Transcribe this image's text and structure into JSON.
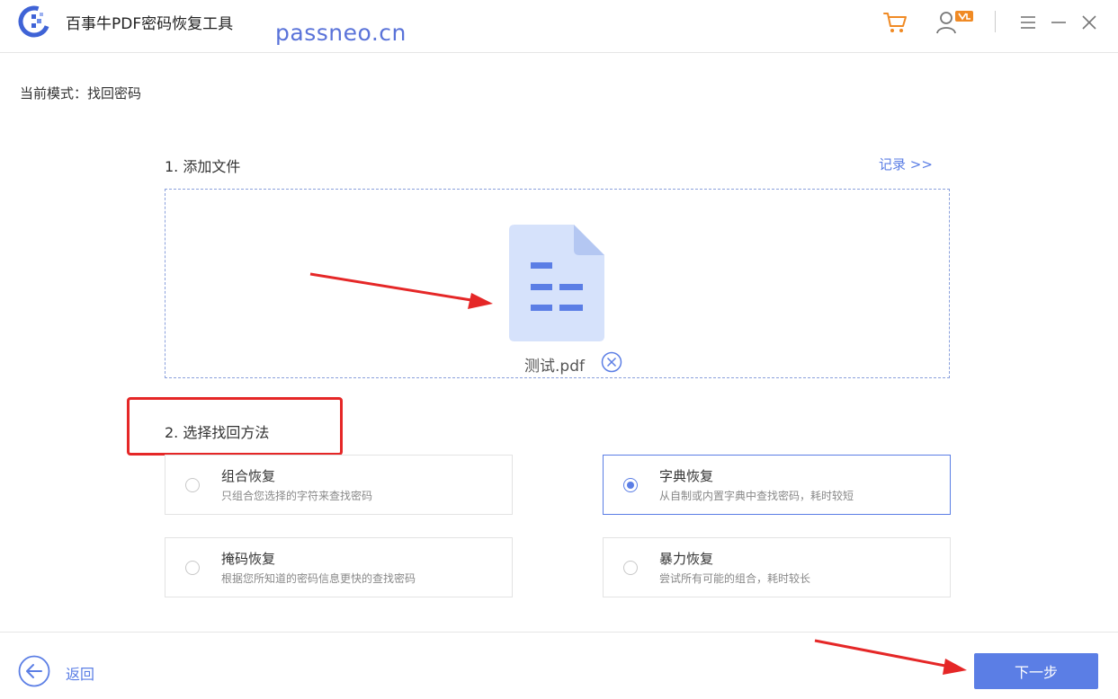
{
  "titlebar": {
    "app_title": "百事牛PDF密码恢复工具",
    "watermark": "passneo.cn",
    "icons": [
      "cart-icon",
      "user-vip-icon",
      "menu-icon",
      "minimize-icon",
      "close-icon"
    ]
  },
  "mode": {
    "label": "当前模式：找回密码"
  },
  "section1": {
    "title": "1. 添加文件",
    "record_link": "记录 >>"
  },
  "file": {
    "name": "测试.pdf",
    "icon": "pdf-file-icon"
  },
  "section2": {
    "title": "2. 选择找回方法"
  },
  "options": [
    {
      "title": "组合恢复",
      "desc": "只组合您选择的字符来查找密码",
      "selected": false
    },
    {
      "title": "字典恢复",
      "desc": "从自制或内置字典中查找密码，耗时较短",
      "selected": true
    },
    {
      "title": "掩码恢复",
      "desc": "根据您所知道的密码信息更快的查找密码",
      "selected": false
    },
    {
      "title": "暴力恢复",
      "desc": "尝试所有可能的组合，耗时较长",
      "selected": false
    }
  ],
  "footer": {
    "back_label": "返回",
    "next_label": "下一步"
  },
  "colors": {
    "accent": "#5b7ee5",
    "highlight": "#e52727",
    "vip_badge": "#f08a24"
  }
}
